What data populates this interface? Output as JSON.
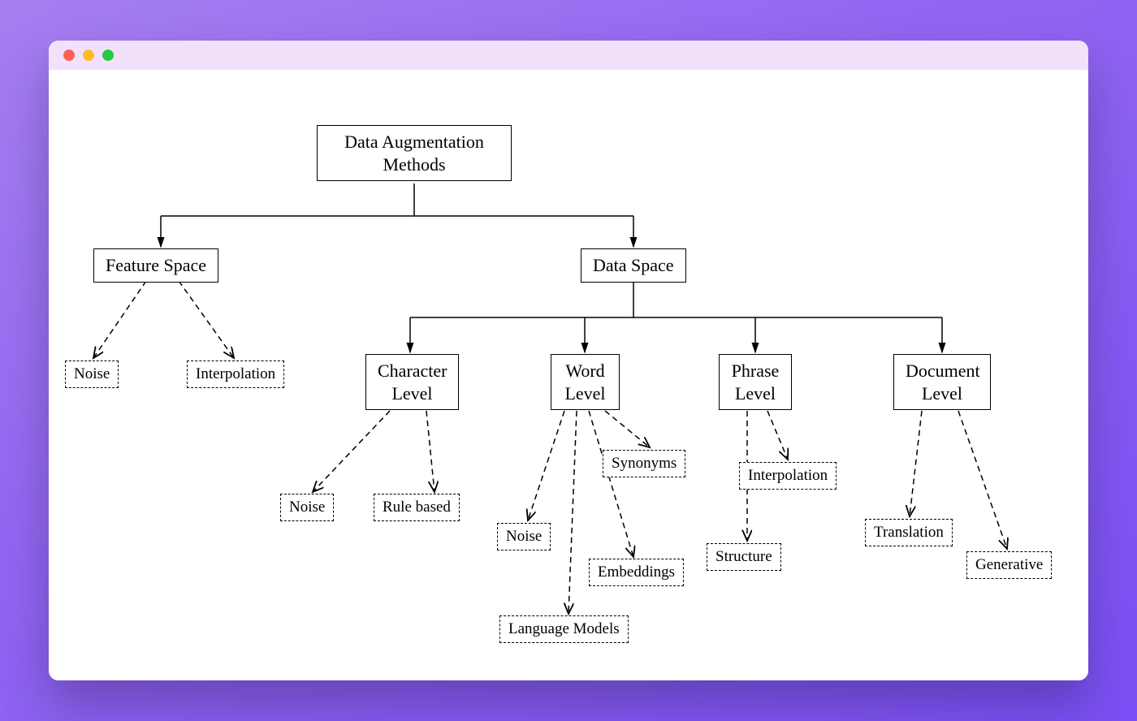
{
  "root": {
    "label": "Data Augmentation\nMethods"
  },
  "feature_space": {
    "label": "Feature Space"
  },
  "data_space": {
    "label": "Data Space"
  },
  "feature_space_children": {
    "noise": "Noise",
    "interpolation": "Interpolation"
  },
  "data_space_children": {
    "character_level": "Character\nLevel",
    "word_level": "Word\nLevel",
    "phrase_level": "Phrase\nLevel",
    "document_level": "Document\nLevel"
  },
  "character_level_children": {
    "noise": "Noise",
    "rule_based": "Rule based"
  },
  "word_level_children": {
    "noise": "Noise",
    "synonyms": "Synonyms",
    "embeddings": "Embeddings",
    "language_models": "Language Models"
  },
  "phrase_level_children": {
    "interpolation": "Interpolation",
    "structure": "Structure"
  },
  "document_level_children": {
    "translation": "Translation",
    "generative": "Generative"
  },
  "colors": {
    "window_titlebar": "#f3e1fb",
    "bg_gradient_start": "#a67ff0",
    "bg_gradient_end": "#7a4ff5"
  }
}
